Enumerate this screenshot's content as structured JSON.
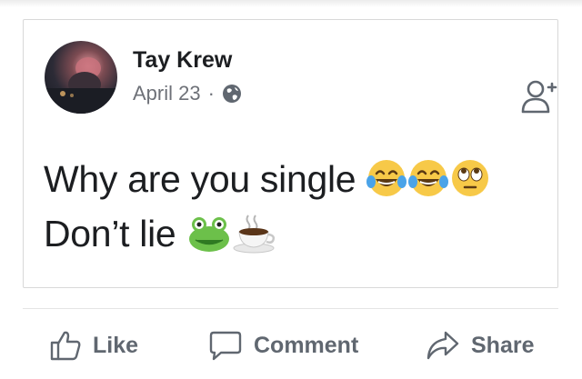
{
  "post": {
    "author": "Tay Krew",
    "date": "April 23",
    "separator": "·",
    "privacy_icon": "globe-icon",
    "line1": "Why are you single ",
    "line2": "Don’t lie "
  },
  "actions": {
    "like": "Like",
    "comment": "Comment",
    "share": "Share"
  },
  "colors": {
    "text": "#1c1e21",
    "secondary": "#6e7178",
    "action": "#606770",
    "border": "#d8d8d8"
  }
}
